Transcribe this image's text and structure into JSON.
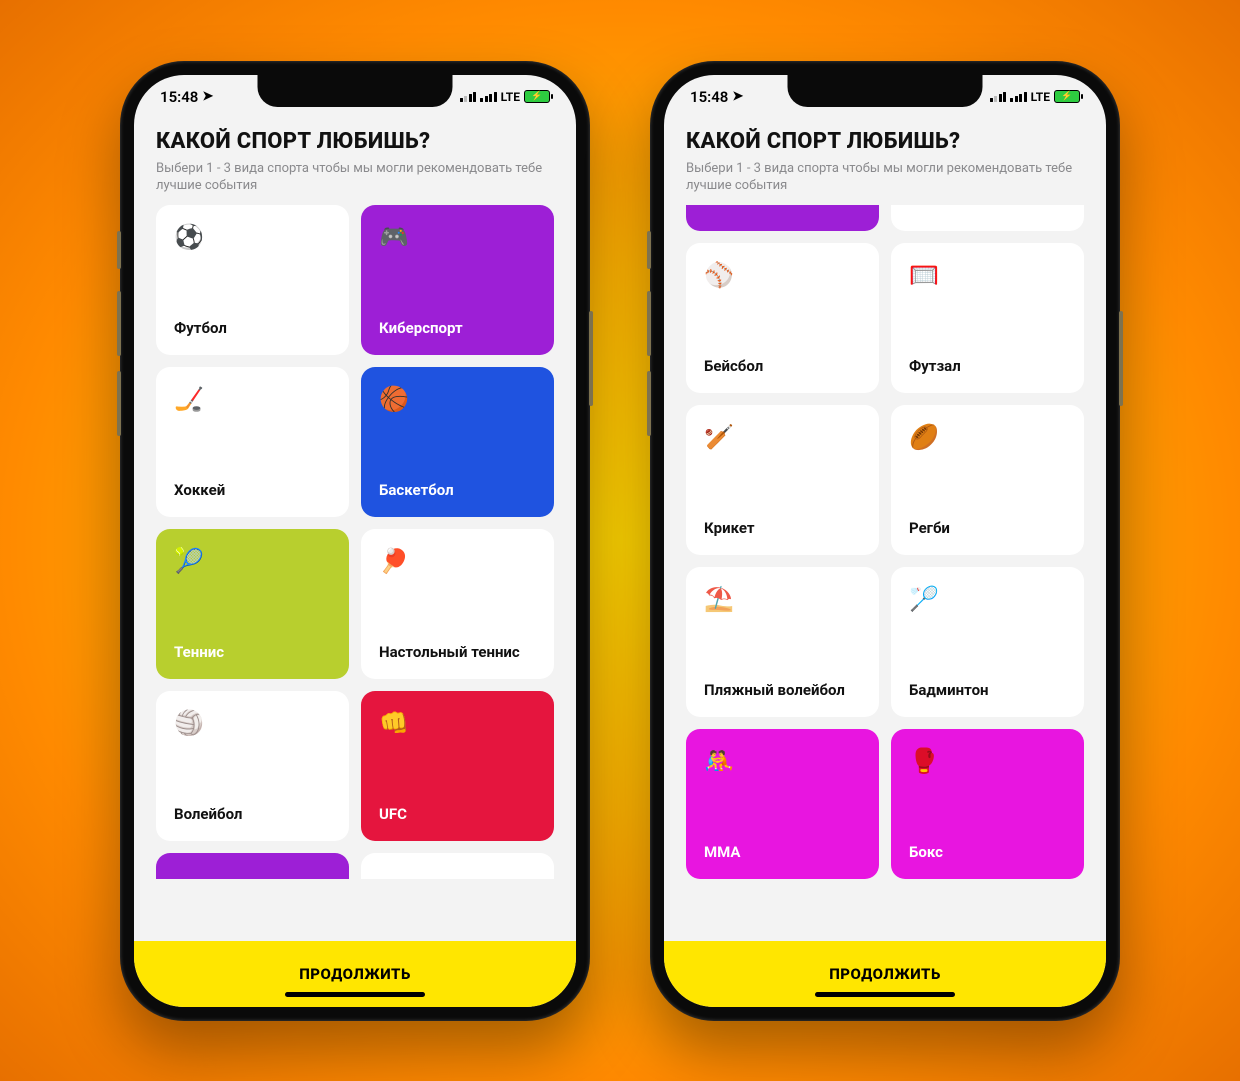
{
  "status": {
    "time": "15:48",
    "network": "LTE"
  },
  "header": {
    "title": "КАКОЙ СПОРТ ЛЮБИШЬ?",
    "subtitle": "Выбери 1 - 3 вида спорта чтобы мы могли рекомендовать тебе лучшие события"
  },
  "cta": {
    "label": "ПРОДОЛЖИТЬ"
  },
  "colors": {
    "purple": "#9d1fd6",
    "blue": "#1f53e0",
    "olive": "#b8cf2e",
    "red": "#e5153e",
    "magenta": "#e815e0"
  },
  "phone1_cards": [
    {
      "icon": "⚽",
      "label": "Футбол",
      "sel": false
    },
    {
      "icon": "🎮",
      "label": "Киберспорт",
      "sel": true,
      "color": "purple"
    },
    {
      "icon": "🏒",
      "label": "Хоккей",
      "sel": false
    },
    {
      "icon": "🏀",
      "label": "Баскетбол",
      "sel": true,
      "color": "blue"
    },
    {
      "icon": "🎾",
      "label": "Теннис",
      "sel": true,
      "color": "olive"
    },
    {
      "icon": "🏓",
      "label": "Настольный теннис",
      "sel": false
    },
    {
      "icon": "🏐",
      "label": "Волейбол",
      "sel": false
    },
    {
      "icon": "👊",
      "label": "UFC",
      "sel": true,
      "color": "red"
    }
  ],
  "phone1_peek": [
    {
      "color": "purple"
    },
    {
      "color": null
    }
  ],
  "phone2_peek_top": [
    {
      "color": "purple"
    },
    {
      "color": null
    }
  ],
  "phone2_cards": [
    {
      "icon": "⚾",
      "label": "Бейсбол",
      "sel": false
    },
    {
      "icon": "🥅",
      "label": "Футзал",
      "sel": false
    },
    {
      "icon": "🏏",
      "label": "Крикет",
      "sel": false
    },
    {
      "icon": "🏉",
      "label": "Регби",
      "sel": false
    },
    {
      "icon": "⛱️",
      "label": "Пляжный волейбол",
      "sel": false
    },
    {
      "icon": "🏸",
      "label": "Бадминтон",
      "sel": false
    },
    {
      "icon": "🤼",
      "label": "MMA",
      "sel": true,
      "color": "magenta"
    },
    {
      "icon": "🥊",
      "label": "Бокс",
      "sel": true,
      "color": "magenta"
    }
  ]
}
